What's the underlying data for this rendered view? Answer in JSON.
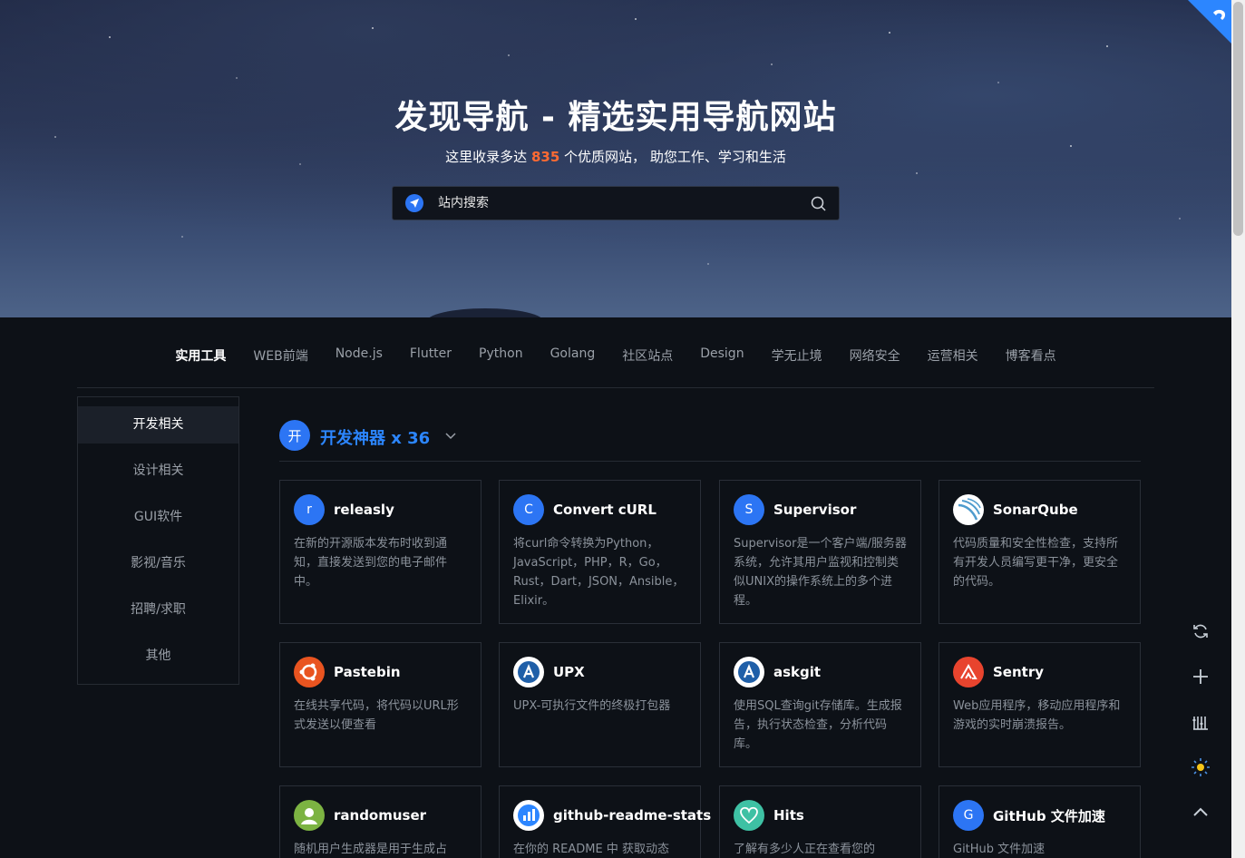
{
  "hero": {
    "title": "发现导航 - 精选实用导航网站",
    "subtitle_prefix": "这里收录多达",
    "site_count": "835",
    "subtitle_suffix": "个优质网站， 助您工作、学习和生活"
  },
  "search": {
    "placeholder": "站内搜索",
    "engine_icon": "compass-icon",
    "button_icon": "search-icon"
  },
  "tabs": [
    "实用工具",
    "WEB前端",
    "Node.js",
    "Flutter",
    "Python",
    "Golang",
    "社区站点",
    "Design",
    "学无止境",
    "网络安全",
    "运营相关",
    "博客看点"
  ],
  "sidebar": {
    "items": [
      "开发相关",
      "设计相关",
      "GUI软件",
      "影视/音乐",
      "招聘/求职",
      "其他"
    ]
  },
  "category": {
    "badge": "开",
    "title": "开发神器 x 36"
  },
  "cards": [
    {
      "name": "releasly",
      "icon_text": "r",
      "icon_color": "#2c75f4",
      "desc": "在新的开源版本发布时收到通知，直接发送到您的电子邮件中。"
    },
    {
      "name": "Convert cURL",
      "icon_text": "C",
      "icon_color": "#2c75f4",
      "desc": "将curl命令转换为Python，JavaScript，PHP，R，Go，Rust，Dart，JSON，Ansible，Elixir。"
    },
    {
      "name": "Supervisor",
      "icon_text": "S",
      "icon_color": "#2c75f4",
      "desc": "Supervisor是一个客户端/服务器系统，允许其用户监视和控制类似UNIX的操作系统上的多个进程。"
    },
    {
      "name": "SonarQube",
      "icon_text": "",
      "icon_color": "#ffffff",
      "desc": "代码质量和安全性检查，支持所有开发人员编写更干净，更安全的代码。"
    },
    {
      "name": "Pastebin",
      "icon_text": "",
      "icon_color": "#e95420",
      "desc": "在线共享代码，将代码以URL形式发送以便查看"
    },
    {
      "name": "UPX",
      "icon_text": "A",
      "icon_color": "#ffffff",
      "desc": "UPX-可执行文件的终极打包器"
    },
    {
      "name": "askgit",
      "icon_text": "A",
      "icon_color": "#ffffff",
      "desc": "使用SQL查询git存储库。生成报告，执行状态检查，分析代码库。"
    },
    {
      "name": "Sentry",
      "icon_text": "",
      "icon_color": "#e8442e",
      "desc": "Web应用程序，移动应用程序和游戏的实时崩溃报告。"
    },
    {
      "name": "randomuser",
      "icon_text": "",
      "icon_color": "#7cb342",
      "desc": "随机用户生成器是用于生成占"
    },
    {
      "name": "github-readme-stats",
      "icon_text": "",
      "icon_color": "#ffffff",
      "desc": "在你的 README 中 获取动态"
    },
    {
      "name": "Hits",
      "icon_text": "",
      "icon_color": "#3ec1a4",
      "desc": "了解有多少人正在查看您的"
    },
    {
      "name": "GitHub 文件加速",
      "icon_text": "G",
      "icon_color": "#2c75f4",
      "desc": "GitHub 文件加速"
    }
  ],
  "tools": [
    "refresh-icon",
    "plus-icon",
    "sliders-icon",
    "theme-sun-icon",
    "back-to-top-icon"
  ]
}
